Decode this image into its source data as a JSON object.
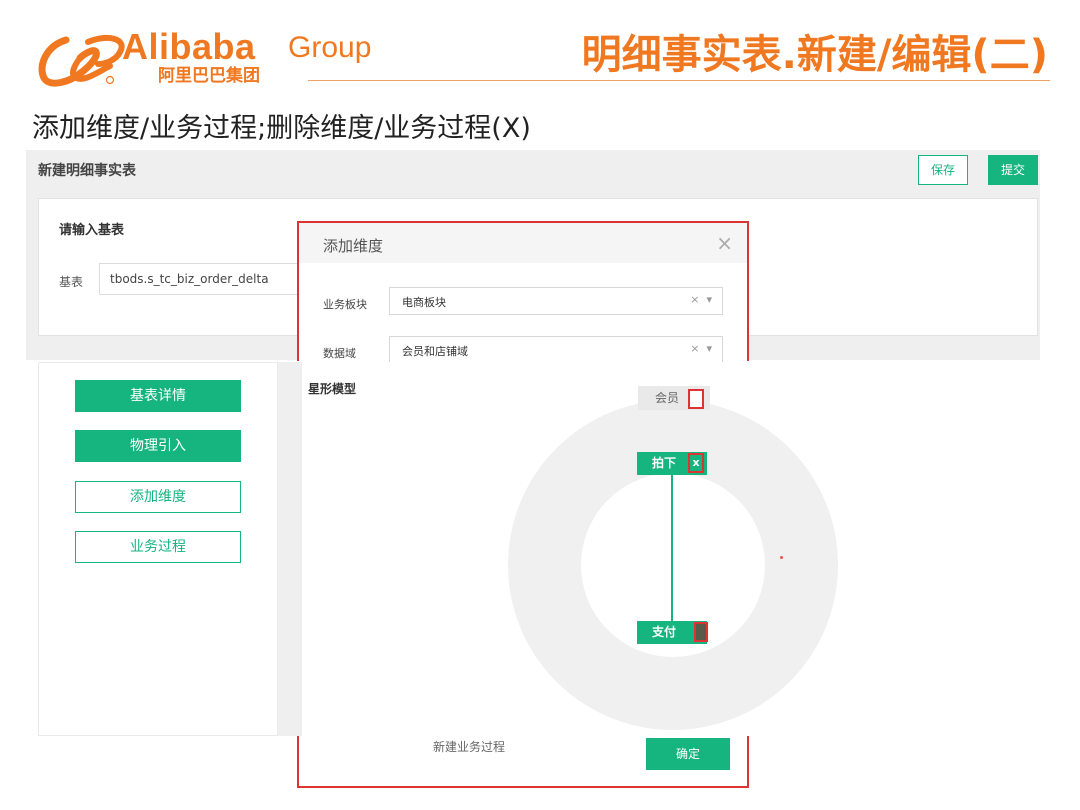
{
  "slide": {
    "brand": "Alibaba",
    "brand_group": "Group",
    "brand_cn": "阿里巴巴集团",
    "title": "明细事实表.新建/编辑(二)",
    "subtitle": "添加维度/业务过程;删除维度/业务过程(X)",
    "accent_color": "#f07820"
  },
  "app": {
    "page_title": "新建明细事实表",
    "save_label": "保存",
    "submit_label": "提交",
    "base": {
      "heading": "请输入基表",
      "label": "基表",
      "value": "tbods.s_tc_biz_order_delta"
    },
    "sidebar": {
      "items": [
        {
          "label": "基表详情",
          "style": "solid"
        },
        {
          "label": "物理引入",
          "style": "solid"
        },
        {
          "label": "添加维度",
          "style": "outline"
        },
        {
          "label": "业务过程",
          "style": "outline"
        }
      ]
    },
    "dialog": {
      "title": "添加维度",
      "close_icon": "close-icon",
      "fields": [
        {
          "label": "业务板块",
          "value": "电商板块"
        },
        {
          "label": "数据域",
          "value": "会员和店铺域"
        }
      ],
      "new_process_label": "新建业务过程",
      "confirm_label": "确定"
    },
    "star_model": {
      "title": "星形模型",
      "nodes": {
        "member": "会员",
        "pai": "拍下",
        "pay": "支付"
      },
      "delete_mark": "x"
    },
    "brand_color": "#16b47e",
    "highlight_color": "#dd3333"
  }
}
